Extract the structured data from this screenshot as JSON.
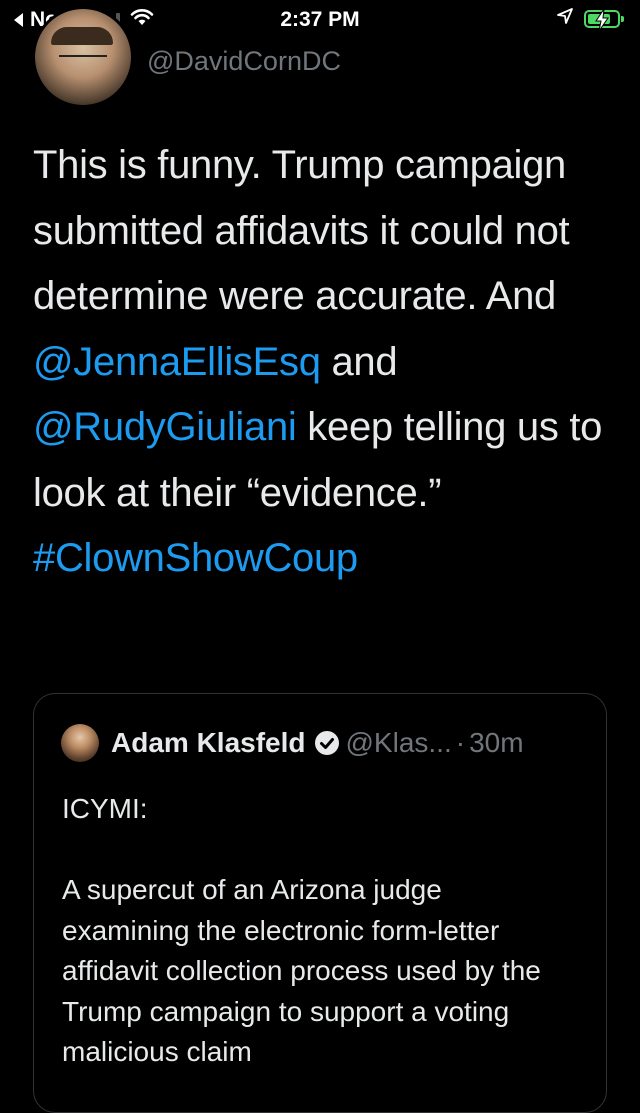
{
  "status_bar": {
    "back_app": "Notes",
    "time": "2:37 PM",
    "colors": {
      "battery": "#4cd964"
    }
  },
  "tweet": {
    "handle": "@DavidCornDC",
    "text_parts": {
      "p1": "This is funny. Trump campaign submitted affidavits it could not determine were accurate. And ",
      "mention1": "@JennaEllisEsq",
      "p2": " and ",
      "mention2": "@RudyGiuliani",
      "p3": " keep telling us to look at their “evidence.” ",
      "hashtag": "#ClownShowCoup"
    },
    "link_color": "#1d9bf0"
  },
  "quoted_tweet": {
    "name": "Adam Klasfeld",
    "handle": "@Klas...",
    "separator": "·",
    "time": "30m",
    "body_line1": "ICYMI:",
    "body_line2": "A supercut of an Arizona judge examining the electronic form-letter affidavit collection process used by the Trump campaign to support a voting malicious claim"
  },
  "icons": [
    "back-icon",
    "signal-icon",
    "wifi-icon",
    "location-icon",
    "battery-icon",
    "verified-icon"
  ]
}
